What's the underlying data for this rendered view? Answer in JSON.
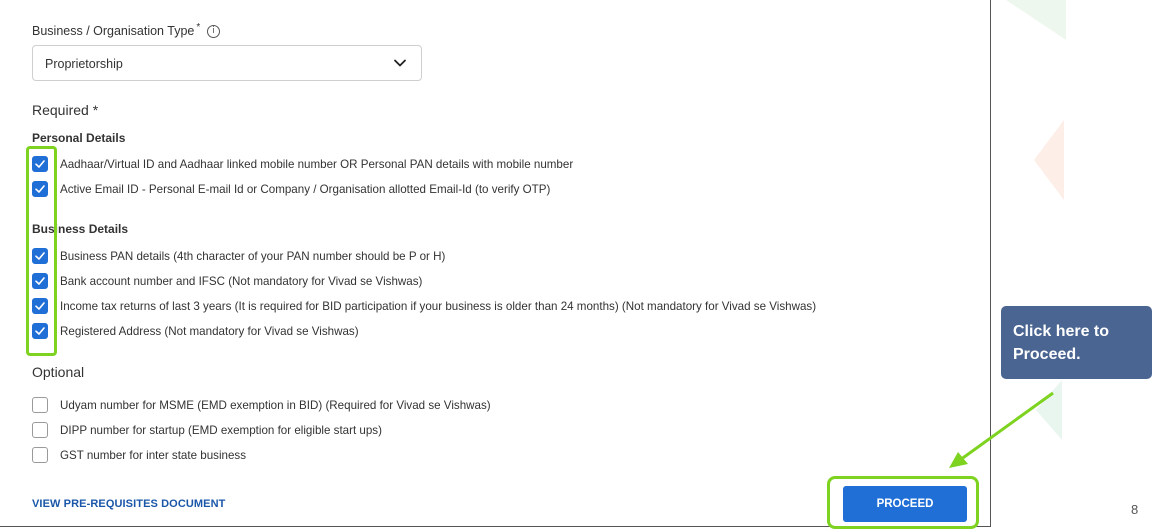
{
  "form": {
    "org_type_label": "Business / Organisation Type",
    "required_mark": "*",
    "info_glyph": "i",
    "org_type_value": "Proprietorship",
    "required_title": "Required *",
    "personal_title": "Personal Details",
    "personal_items": [
      {
        "text": "Aadhaar/Virtual ID and Aadhaar linked mobile number OR Personal PAN details with mobile number",
        "checked": true
      },
      {
        "text": "Active Email ID - Personal E-mail Id or Company / Organisation allotted Email-Id (to verify OTP)",
        "checked": true
      }
    ],
    "business_title": "Business Details",
    "business_items": [
      {
        "text": "Business PAN details (4th character of your PAN number should be P or H)",
        "checked": true
      },
      {
        "text": "Bank account number and IFSC (Not mandatory for Vivad se Vishwas)",
        "checked": true
      },
      {
        "text": "Income tax returns of last 3 years (It is required for BID participation if your business is older than 24 months) (Not mandatory for Vivad se Vishwas)",
        "checked": true
      },
      {
        "text": "Registered Address (Not mandatory for Vivad se Vishwas)",
        "checked": true
      }
    ],
    "optional_title": "Optional",
    "optional_items": [
      {
        "text": "Udyam number for MSME (EMD exemption in BID) (Required for Vivad se Vishwas)",
        "checked": false
      },
      {
        "text": "DIPP number for startup (EMD exemption for eligible start ups)",
        "checked": false
      },
      {
        "text": "GST number for inter state business",
        "checked": false
      }
    ],
    "link_label": "VIEW PRE-REQUISITES DOCUMENT",
    "proceed_label": "PROCEED"
  },
  "callout": {
    "line1": "Click here to",
    "line2": "Proceed."
  },
  "page_number": "8",
  "colors": {
    "primary": "#1f6fd6",
    "highlight": "#7ed321",
    "callout": "#4a6591",
    "link": "#1a57a8"
  }
}
